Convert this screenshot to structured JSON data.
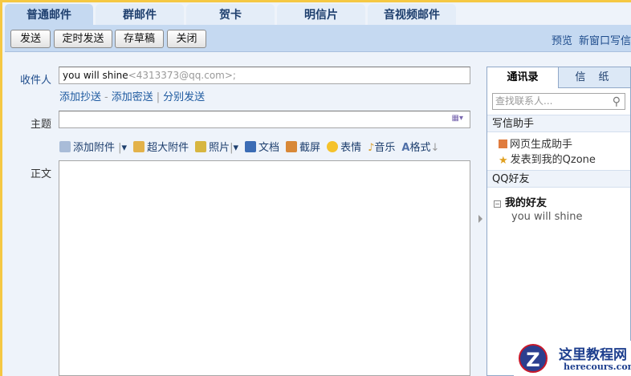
{
  "tabs": [
    "普通邮件",
    "群邮件",
    "贺卡",
    "明信片",
    "音视频邮件"
  ],
  "toolbar": {
    "send": "发送",
    "timed_send": "定时发送",
    "save_draft": "存草稿",
    "close": "关闭",
    "preview": "预览",
    "new_window": "新窗口写信"
  },
  "compose": {
    "to_label": "收件人",
    "to_name": "you will shine",
    "to_addr": "<4313373@qq.com>;",
    "add_cc": "添加抄送",
    "add_bcc": "添加密送",
    "separate_send": "分别发送",
    "subject_label": "主题",
    "subject_value": "",
    "body_label": "正文"
  },
  "tools": [
    "添加附件",
    "超大附件",
    "照片",
    "文档",
    "截屏",
    "表情",
    "音乐",
    "格式"
  ],
  "side": {
    "tab_contacts": "通讯录",
    "tab_stationery": "信 纸",
    "search_placeholder": "查找联系人...",
    "helper_title": "写信助手",
    "helper_items": [
      "网页生成助手",
      "发表到我的Qzone"
    ],
    "qq_title": "QQ好友",
    "group": "我的好友",
    "friend": "you will shine"
  },
  "watermark": {
    "title": "这里教程网",
    "url": "herecours.com"
  }
}
